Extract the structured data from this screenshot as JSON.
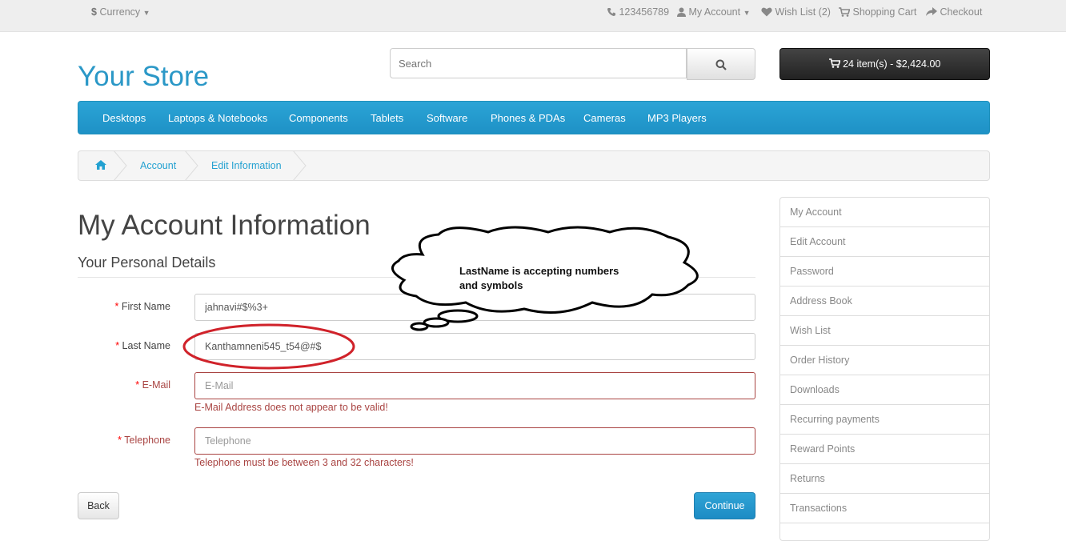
{
  "topbar": {
    "currency": "Currency",
    "phone": "123456789",
    "my_account": "My Account",
    "wish_list": "Wish List (2)",
    "shopping_cart": "Shopping Cart",
    "checkout": "Checkout"
  },
  "header": {
    "logo": "Your Store",
    "search_placeholder": "Search",
    "cart_button": "24 item(s) - $2,424.00"
  },
  "menu": {
    "items": [
      "Desktops",
      "Laptops & Notebooks",
      "Components",
      "Tablets",
      "Software",
      "Phones & PDAs",
      "Cameras",
      "MP3 Players"
    ]
  },
  "breadcrumb": {
    "items": [
      "Account",
      "Edit Information"
    ]
  },
  "page": {
    "title": "My Account Information",
    "section": "Your Personal Details"
  },
  "form": {
    "required_marker": "*",
    "first_name": {
      "label": "First Name",
      "value": "jahnavi#$%3+"
    },
    "last_name": {
      "label": "Last Name",
      "value": "Kanthamneni545_t54@#$"
    },
    "email": {
      "label": "E-Mail",
      "placeholder": "E-Mail",
      "error": "E-Mail Address does not appear to be valid!"
    },
    "telephone": {
      "label": "Telephone",
      "placeholder": "Telephone",
      "error": "Telephone must be between 3 and 32 characters!"
    },
    "back": "Back",
    "continue": "Continue"
  },
  "sidebar": {
    "items": [
      "My Account",
      "Edit Account",
      "Password",
      "Address Book",
      "Wish List",
      "Order History",
      "Downloads",
      "Recurring payments",
      "Reward Points",
      "Returns",
      "Transactions"
    ]
  },
  "annotation": {
    "text": "LastName is accepting numbers and symbols",
    "highlight_color": "#d0222a"
  },
  "colors": {
    "brand": "#2b98c7",
    "menu": "#229ac8",
    "error": "#a94442"
  }
}
